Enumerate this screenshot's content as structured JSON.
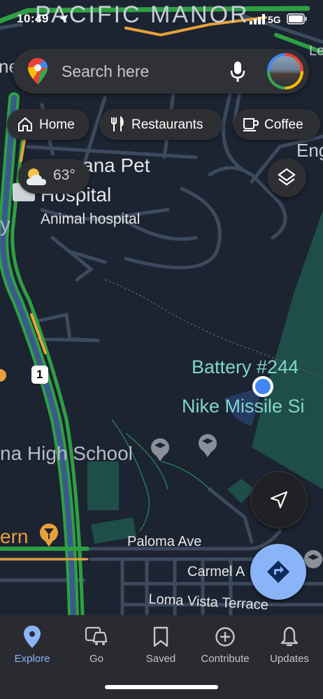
{
  "status_bar": {
    "time": "10:49",
    "network": "5G"
  },
  "search": {
    "placeholder": "Search here"
  },
  "chips": [
    {
      "label": "Home",
      "icon": "home-icon"
    },
    {
      "label": "Restaurants",
      "icon": "fork-knife-icon"
    },
    {
      "label": "Coffee",
      "icon": "coffee-cup-icon"
    }
  ],
  "weather": {
    "temperature": "63°",
    "icon": "partly-cloudy-icon"
  },
  "map_labels": {
    "area": "PACIFIC MANOR",
    "edge_top_right": "Le",
    "edge_left_top": "ne",
    "edge_right_eng": "Eng",
    "edge_left_y": "y",
    "poi_hospital_line1": "ana Pet",
    "poi_hospital_line2": "Hospital",
    "poi_hospital_sub": "Animal hospital",
    "poi_battery": "Battery #244",
    "poi_nike": "Nike Missile Si",
    "poi_school": "na High School",
    "poi_tavern": "ern",
    "street_paloma": "Paloma Ave",
    "street_carmel": "Carmel A",
    "street_loma": "Loma Vista Terrace",
    "highway_shield": "1"
  },
  "colors": {
    "map_bg": "#1c2331",
    "road": "#3c4a5e",
    "highway_green": "#2ea043",
    "highway_orange": "#e8a13a",
    "park": "#1f4d47",
    "poi_teal": "#7fd6cc",
    "location_blue": "#4285f4",
    "directions_btn": "#8ab4f8",
    "nav_active": "#8ab4f8"
  },
  "nav": [
    {
      "label": "Explore",
      "icon": "explore-pin-icon",
      "active": true
    },
    {
      "label": "Go",
      "icon": "commute-car-icon",
      "active": false
    },
    {
      "label": "Saved",
      "icon": "bookmark-icon",
      "active": false
    },
    {
      "label": "Contribute",
      "icon": "add-circle-icon",
      "active": false
    },
    {
      "label": "Updates",
      "icon": "bell-icon",
      "active": false
    }
  ]
}
